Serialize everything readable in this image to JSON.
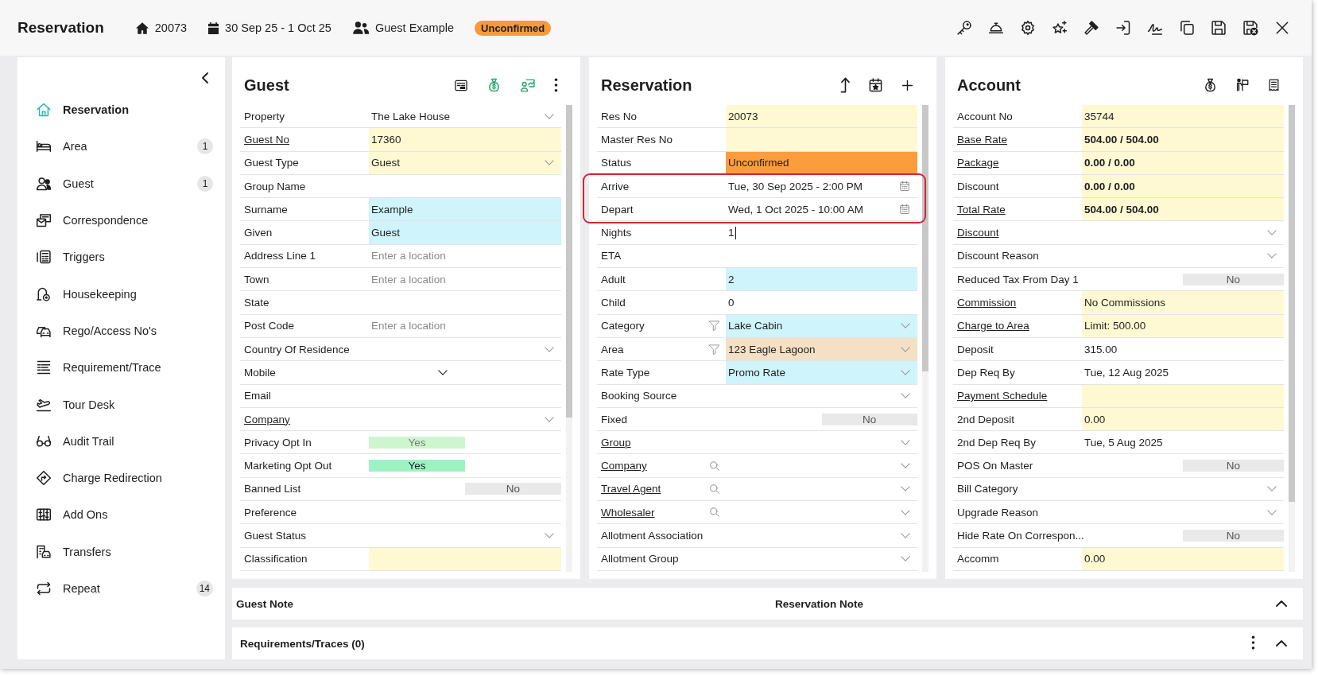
{
  "header": {
    "title": "Reservation",
    "reservation_no": "20073",
    "dates": "30 Sep 25 - 1 Oct 25",
    "guest_name": "Guest Example",
    "status": "Unconfirmed"
  },
  "sidebar": {
    "items": [
      {
        "label": "Reservation",
        "selected": true
      },
      {
        "label": "Area",
        "selected": false,
        "count": "1"
      },
      {
        "label": "Guest",
        "selected": false,
        "count": "1"
      },
      {
        "label": "Correspondence",
        "selected": false
      },
      {
        "label": "Triggers",
        "selected": false
      },
      {
        "label": "Housekeeping",
        "selected": false
      },
      {
        "label": "Rego/Access No's",
        "selected": false
      },
      {
        "label": "Requirement/Trace",
        "selected": false
      },
      {
        "label": "Tour Desk",
        "selected": false
      },
      {
        "label": "Audit Trail",
        "selected": false
      },
      {
        "label": "Charge Redirection",
        "selected": false
      },
      {
        "label": "Add Ons",
        "selected": false
      },
      {
        "label": "Transfers",
        "selected": false
      },
      {
        "label": "Repeat",
        "selected": false,
        "count": "14"
      }
    ]
  },
  "guest_panel": {
    "title": "Guest",
    "rows": [
      {
        "label": "Property",
        "kind": "select",
        "value": "The Lake House",
        "link": false
      },
      {
        "label": "Guest No",
        "kind": "text",
        "value": "17360",
        "color": "#fff9d3",
        "link": true
      },
      {
        "label": "Guest Type",
        "kind": "select",
        "value": "Guest",
        "color": "#fff9d3",
        "link": false
      },
      {
        "label": "Group Name",
        "kind": "text",
        "link": false
      },
      {
        "label": "Surname",
        "kind": "text",
        "value": "Example",
        "color": "#cff4fb",
        "link": false
      },
      {
        "label": "Given",
        "kind": "text",
        "value": "Guest",
        "color": "#cff4fb",
        "link": false
      },
      {
        "label": "Address Line 1",
        "kind": "text",
        "placeholder": "Enter a location",
        "link": false
      },
      {
        "label": "Town",
        "kind": "text",
        "placeholder": "Enter a location",
        "link": false
      },
      {
        "label": "State",
        "kind": "text",
        "link": false
      },
      {
        "label": "Post Code",
        "kind": "text",
        "placeholder": "Enter a location",
        "link": false
      },
      {
        "label": "Country Of Residence",
        "kind": "select",
        "link": false
      },
      {
        "label": "Mobile",
        "kind": "phone",
        "link": false
      },
      {
        "label": "Email",
        "kind": "text",
        "link": false
      },
      {
        "label": "Company",
        "kind": "select",
        "link": true
      },
      {
        "label": "Privacy Opt In",
        "kind": "toggle",
        "value": "Yes",
        "on": true,
        "disabled": true,
        "link": false
      },
      {
        "label": "Marketing Opt Out",
        "kind": "toggle",
        "value": "Yes",
        "on": true,
        "disabled": false,
        "link": false
      },
      {
        "label": "Banned List",
        "kind": "toggle",
        "value": "No",
        "on": false,
        "disabled": false,
        "link": false
      },
      {
        "label": "Preference",
        "kind": "text",
        "link": false
      },
      {
        "label": "Guest Status",
        "kind": "select",
        "link": false
      },
      {
        "label": "Classification",
        "kind": "text",
        "color": "#fff9d3",
        "link": false
      }
    ]
  },
  "reservation_panel": {
    "title": "Reservation",
    "rows": [
      {
        "label": "Res No",
        "kind": "text",
        "value": "20073",
        "color": "#fff9d3",
        "link": false,
        "highlighted": false
      },
      {
        "label": "Master Res No",
        "kind": "text",
        "color": "#fff9d3",
        "link": false,
        "highlighted": false
      },
      {
        "label": "Status",
        "kind": "text",
        "value": "Unconfirmed",
        "color": "#fb9d3c",
        "link": false,
        "highlighted": false
      },
      {
        "label": "Arrive",
        "kind": "date",
        "value": "Tue, 30 Sep 2025 - 2:00 PM",
        "link": false,
        "highlighted": true
      },
      {
        "label": "Depart",
        "kind": "date",
        "value": "Wed, 1 Oct 2025 - 10:00 AM",
        "link": false,
        "highlighted": true
      },
      {
        "label": "Nights",
        "kind": "input",
        "value": "1",
        "focused": true,
        "link": false,
        "highlighted": false
      },
      {
        "label": "ETA",
        "kind": "text",
        "link": false,
        "highlighted": false
      },
      {
        "label": "Adult",
        "kind": "text",
        "value": "2",
        "color": "#cff4fb",
        "link": false,
        "highlighted": false
      },
      {
        "label": "Child",
        "kind": "text",
        "value": "0",
        "link": false,
        "highlighted": false
      },
      {
        "label": "Category",
        "kind": "select",
        "value": "Lake Cabin",
        "color": "#cff4fb",
        "lookup": {
          "kind": "filter"
        },
        "link": false,
        "highlighted": false
      },
      {
        "label": "Area",
        "kind": "select",
        "value": "123 Eagle Lagoon",
        "color": "#f5e0c5",
        "lookup": {
          "kind": "filter"
        },
        "link": false,
        "highlighted": false
      },
      {
        "label": "Rate Type",
        "kind": "select",
        "value": "Promo Rate",
        "color": "#cff4fb",
        "link": false,
        "highlighted": false
      },
      {
        "label": "Booking Source",
        "kind": "select",
        "link": false,
        "highlighted": false
      },
      {
        "label": "Fixed",
        "kind": "toggle",
        "value": "No",
        "on": false,
        "disabled": false,
        "link": false,
        "highlighted": false
      },
      {
        "label": "Group",
        "kind": "select",
        "link": true,
        "highlighted": false
      },
      {
        "label": "Company",
        "kind": "select",
        "lookup": {
          "kind": "search"
        },
        "link": true,
        "highlighted": false
      },
      {
        "label": "Travel Agent",
        "kind": "select",
        "lookup": {
          "kind": "search"
        },
        "link": true,
        "highlighted": false
      },
      {
        "label": "Wholesaler",
        "kind": "select",
        "lookup": {
          "kind": "search"
        },
        "link": true,
        "highlighted": false
      },
      {
        "label": "Allotment Association",
        "kind": "select",
        "link": false,
        "highlighted": false
      },
      {
        "label": "Allotment Group",
        "kind": "select",
        "link": false,
        "highlighted": false
      }
    ]
  },
  "account_panel": {
    "title": "Account",
    "rows": [
      {
        "label": "Account No",
        "kind": "text",
        "value": "35744",
        "color": "#fff9d3",
        "link": false
      },
      {
        "label": "Base Rate",
        "kind": "amount",
        "value": "504.00 / 504.00",
        "color": "#fff9d3",
        "link": true
      },
      {
        "label": "Package",
        "kind": "amount",
        "value": "0.00 / 0.00",
        "color": "#fff9d3",
        "link": true
      },
      {
        "label": "Discount",
        "kind": "amount",
        "value": "0.00 / 0.00",
        "color": "#fff9d3",
        "link": false
      },
      {
        "label": "Total Rate",
        "kind": "amount",
        "value": "504.00 / 504.00",
        "color": "#fff9d3",
        "link": true
      },
      {
        "label": "Discount",
        "kind": "select",
        "link": true
      },
      {
        "label": "Discount Reason",
        "kind": "select",
        "link": false
      },
      {
        "label": "Reduced Tax From Day 1",
        "kind": "toggle",
        "value": "No",
        "on": false,
        "disabled": false,
        "link": false
      },
      {
        "label": "Commission",
        "kind": "text",
        "value": "No Commissions",
        "color": "#fff9d3",
        "link": true
      },
      {
        "label": "Charge to Area",
        "kind": "text",
        "value": "Limit: 500.00",
        "color": "#fff9d3",
        "link": true
      },
      {
        "label": "Deposit",
        "kind": "text",
        "value": "315.00",
        "link": false
      },
      {
        "label": "Dep Req By",
        "kind": "text",
        "value": "Tue, 12 Aug 2025",
        "link": false
      },
      {
        "label": "Payment Schedule",
        "kind": "text",
        "color": "#fff9d3",
        "link": true
      },
      {
        "label": "2nd Deposit",
        "kind": "text",
        "value": "0.00",
        "color": "#fff9d3",
        "link": false
      },
      {
        "label": "2nd Dep Req By",
        "kind": "text",
        "value": "Tue, 5 Aug 2025",
        "link": false
      },
      {
        "label": "POS On Master",
        "kind": "toggle",
        "value": "No",
        "on": false,
        "disabled": false,
        "link": false
      },
      {
        "label": "Bill Category",
        "kind": "select",
        "link": false
      },
      {
        "label": "Upgrade Reason",
        "kind": "select",
        "link": false
      },
      {
        "label": "Hide Rate On Correspon...",
        "kind": "toggle",
        "value": "No",
        "on": false,
        "disabled": false,
        "link": false
      },
      {
        "label": "Accomm",
        "kind": "text",
        "value": "0.00",
        "color": "#fff9d3",
        "link": false
      }
    ]
  },
  "notes_bar": {
    "titles": [
      "Guest Note",
      "Reservation Note"
    ]
  },
  "requirements_bar": {
    "title": "Requirements/Traces (0)"
  }
}
